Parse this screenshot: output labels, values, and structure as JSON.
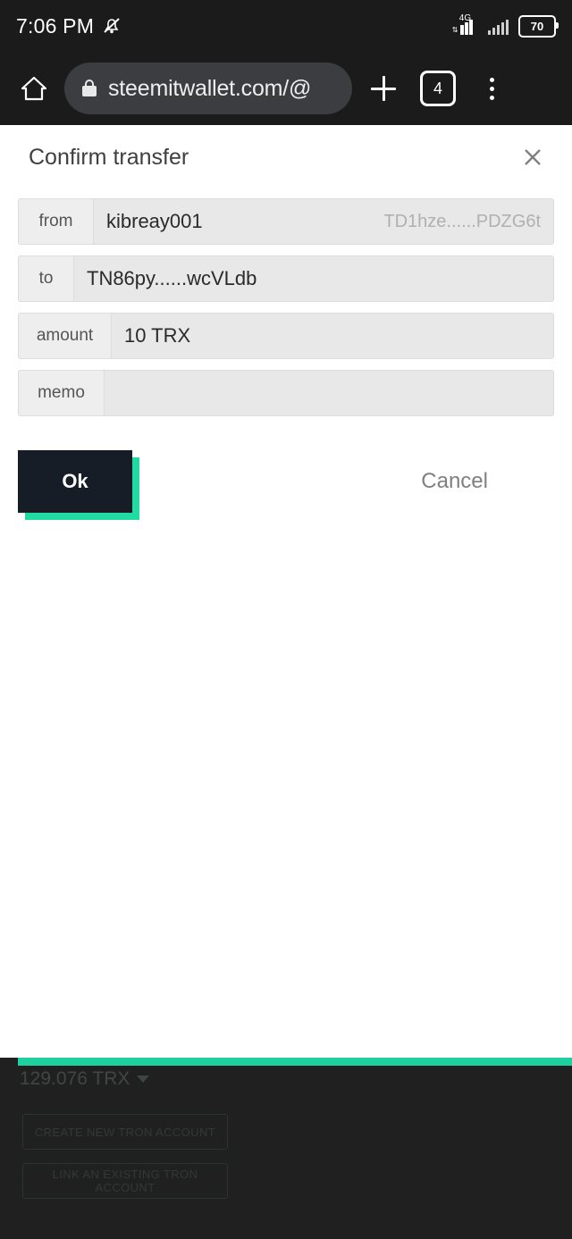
{
  "statusbar": {
    "time": "7:06 PM",
    "mute_icon": "bell-muted-icon",
    "network_label": "4G",
    "battery_level": "70"
  },
  "browser": {
    "home_icon": "home-icon",
    "lock_icon": "lock-icon",
    "url": "steemitwallet.com/@",
    "new_tab_icon": "plus-icon",
    "tab_count": "4",
    "menu_icon": "overflow-menu-icon"
  },
  "modal": {
    "title": "Confirm transfer",
    "close_icon": "close-icon",
    "rows": [
      {
        "label": "from",
        "value": "kibreay001",
        "aux": "TD1hze......PDZG6t"
      },
      {
        "label": "to",
        "value": "TN86py......wcVLdb",
        "aux": ""
      },
      {
        "label": "amount",
        "value": "10  TRX",
        "aux": ""
      },
      {
        "label": "memo",
        "value": "",
        "aux": ""
      }
    ],
    "ok_label": "Ok",
    "cancel_label": "Cancel",
    "accent_color": "#22dba2",
    "ok_fill_color": "#161d26"
  },
  "underlay": {
    "balance": "129.076 TRX",
    "caret_icon": "caret-down-icon",
    "create_account_label": "CREATE NEW TRON ACCOUNT",
    "link_account_label": "LINK AN EXISTING TRON ACCOUNT",
    "accent_bar_color": "#1ecfa0"
  }
}
